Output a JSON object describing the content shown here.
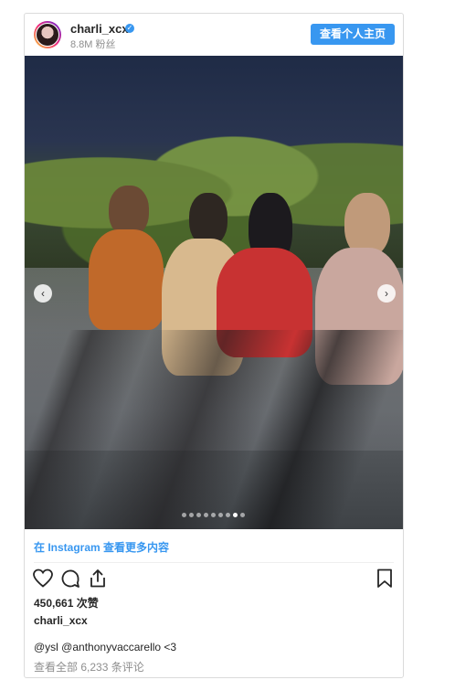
{
  "header": {
    "username": "charli_xcx",
    "verified_icon": "verified-badge-icon",
    "followers": "8.8M 粉丝",
    "profile_button": "查看个人主页"
  },
  "media": {
    "carousel_dots": 9,
    "active_dot": 8,
    "prev_icon": "chevron-left-icon",
    "next_icon": "chevron-right-icon"
  },
  "more_link": "在 Instagram 查看更多内容",
  "actions": {
    "like_icon": "heart-icon",
    "comment_icon": "comment-icon",
    "share_icon": "share-icon",
    "save_icon": "bookmark-icon"
  },
  "likes": "450,661 次赞",
  "caption": {
    "username": "charli_xcx",
    "text": "@ysl @anthonyvaccarello <3"
  },
  "view_comments": "查看全部 6,233 条评论",
  "colors": {
    "accent": "#3897f0",
    "muted": "#8e8e8e",
    "text": "#262626"
  }
}
